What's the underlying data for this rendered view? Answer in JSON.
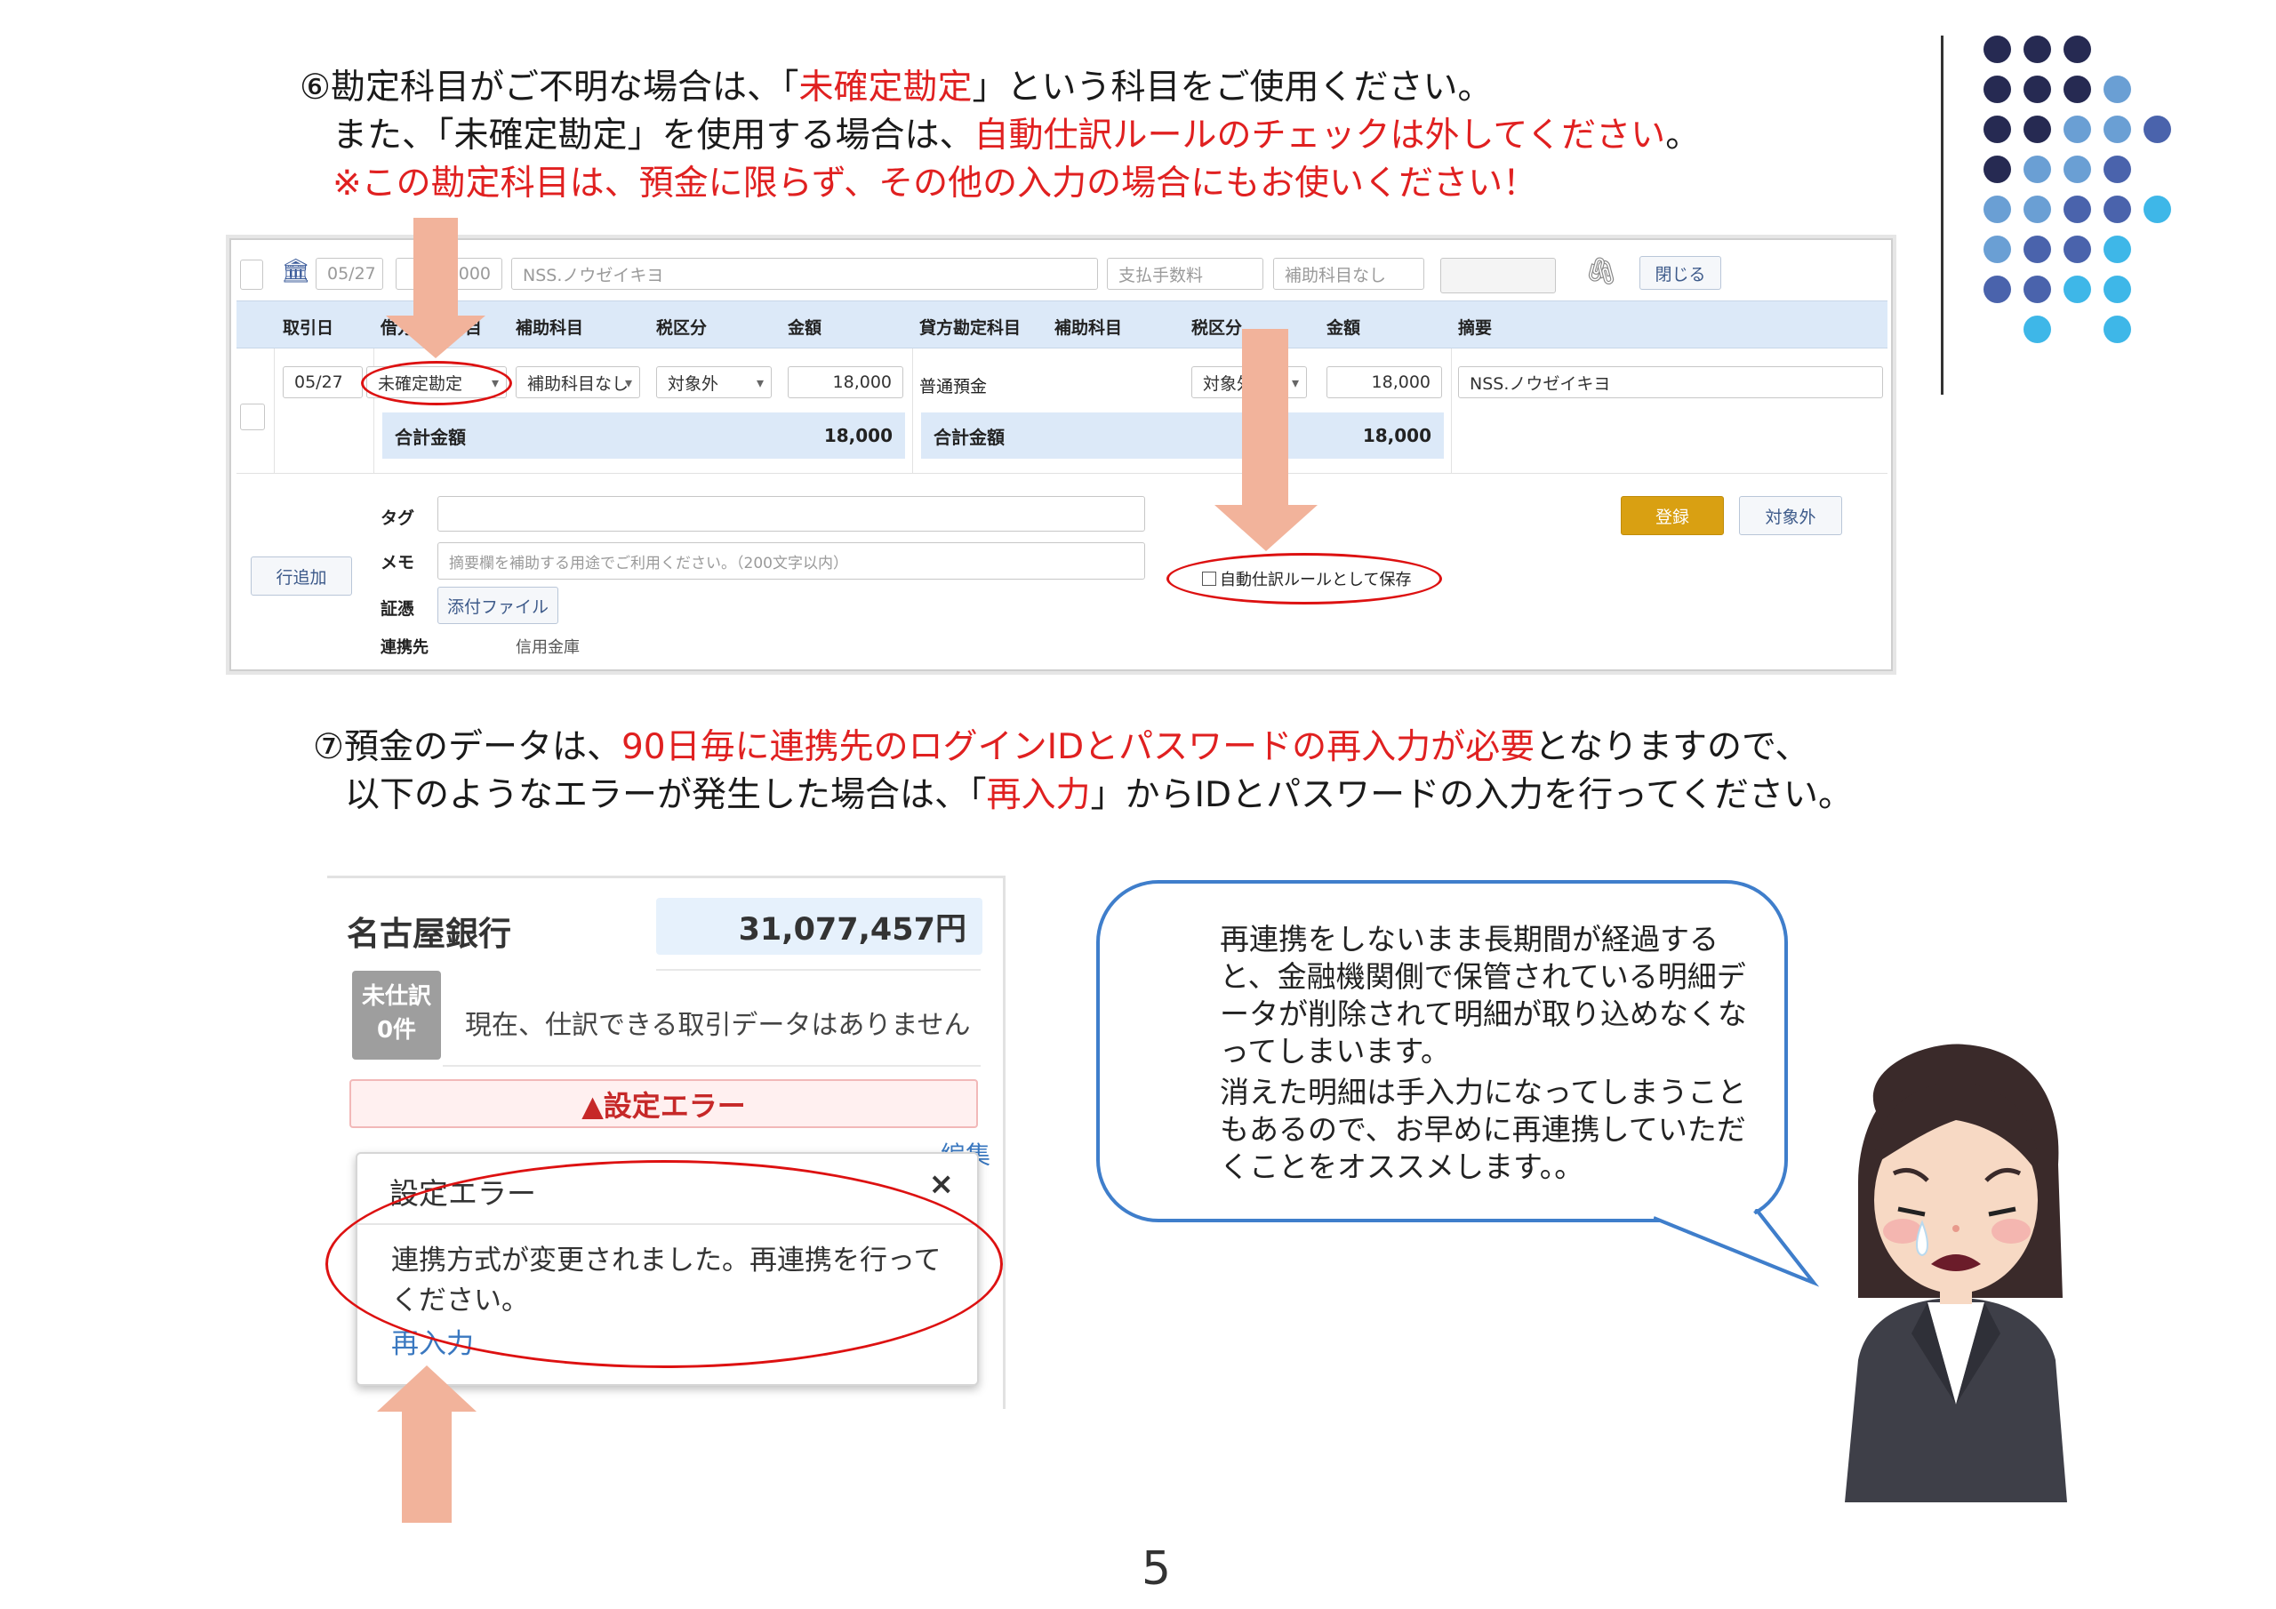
{
  "instructions": {
    "item6": {
      "line1_a": "⑥勘定科目がご不明な場合は、「",
      "line1_red": "未確定勘定",
      "line1_b": "」という科目をご使用ください。",
      "line2_a": "また、「未確定勘定」を使用する場合は、",
      "line2_red": "自動仕訳ルールのチェックは外してください",
      "line2_b": "。",
      "line3_red": "※この勘定科目は、預金に限らず、その他の入力の場合にもお使いください！"
    },
    "item7": {
      "line1_a": "⑦預金のデータは、",
      "line1_red": "90日毎に連携先のログインIDとパスワードの再入力が必要",
      "line1_b": "となりますので、",
      "line2_a": "以下のようなエラーが発生した場合は、「",
      "line2_red": "再入力",
      "line2_b": "」からIDとパスワードの入力を行ってください。"
    }
  },
  "journal_entry": {
    "summary_row": {
      "bank_icon": "bank-icon",
      "date": "05/27",
      "amount": "18,000",
      "description": "NSS.ノウゼイキヨ",
      "fee_placeholder": "支払手数料",
      "sub_account_placeholder": "補助科目なし",
      "attach_icon": "paperclip-icon",
      "close_label": "閉じる"
    },
    "headers": [
      "取引日",
      "借方勘定科目",
      "補助科目",
      "税区分",
      "金額",
      "貸方勘定科目",
      "補助科目",
      "税区分",
      "金額",
      "摘要"
    ],
    "row": {
      "date": "05/27",
      "debit_account": "未確定勘定",
      "debit_sub": "補助科目なし",
      "debit_tax": "対象外",
      "debit_amount": "18,000",
      "credit_account": "普通預金",
      "credit_tax": "対象外",
      "credit_amount": "18,000",
      "description": "NSS.ノウゼイキヨ"
    },
    "totals": {
      "label": "合計金額",
      "debit": "18,000",
      "credit": "18,000"
    },
    "footer": {
      "add_row": "行追加",
      "tag_label": "タグ",
      "memo_label": "メモ",
      "memo_placeholder": "摘要欄を補助する用途でご利用ください。（200文字以内）",
      "evidence_label": "証憑",
      "attach_button": "添付ファイル",
      "partner_label": "連携先",
      "partner_value": "信用金庫",
      "auto_rule_label": "自動仕訳ルールとして保存",
      "register_button": "登録",
      "exclude_button": "対象外"
    },
    "colors": {
      "header_bg": "#dce9f8",
      "register_bg": "#d9a012",
      "highlight": "#dd1111",
      "arrow": "#f2b39b"
    }
  },
  "bank_panel": {
    "bank_name": "名古屋銀行",
    "balance": "31,077,457円",
    "badge_line1": "未仕訳",
    "badge_line2": "0件",
    "message": "現在、仕訳できる取引データはありません",
    "error_banner": "▲設定エラー",
    "side_link": "編集",
    "popup": {
      "title": "設定エラー",
      "close": "×",
      "body": "連携方式が変更されました。再連携を行ってください。",
      "relink": "再入力"
    }
  },
  "speech_bubble": {
    "paragraph1": "再連携をしないまま長期間が経過すると、金融機関側で保管されている明細データが削除されて明細が取り込めなくなってしまいます。",
    "paragraph2": "消えた明細は手入力になってしまうこともあるので、お早めに再連携していただくことをオススメします。。"
  },
  "page_number": "5",
  "decoration": {
    "dot_colors": [
      "#262a52",
      "#6a9fd4",
      "#4a63ac",
      "#3eb7e8"
    ]
  }
}
